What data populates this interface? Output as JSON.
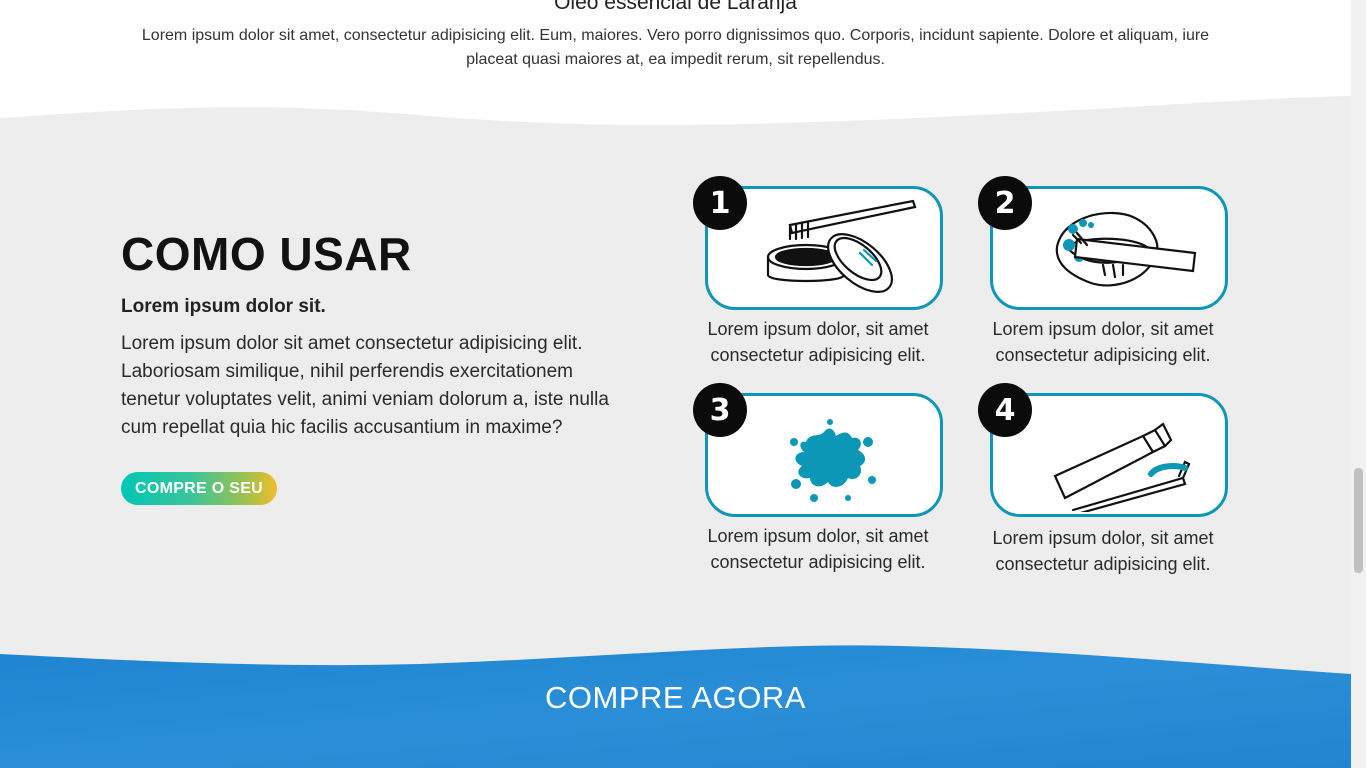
{
  "intro": {
    "title": "Óleo essencial de Laranja",
    "text": "Lorem ipsum dolor sit amet, consectetur adipisicing elit. Eum, maiores. Vero porro dignissimos quo. Corporis, incidunt sapiente. Dolore et aliquam, iure placeat quasi maiores at, ea impedit rerum, sit repellendus."
  },
  "how_to": {
    "title": "COMO USAR",
    "subtitle": "Lorem ipsum dolor sit.",
    "text": "Lorem ipsum dolor sit amet consectetur adipisicing elit. Laboriosam similique, nihil perferendis exercitationem tenetur voluptates velit, animi veniam dolorum a, iste nulla cum repellat quia hic facilis accusantium in maxime?",
    "button_label": "COMPRE O SEU",
    "steps": [
      {
        "number": "1",
        "icon": "toothbrush-powder-jar-icon",
        "caption": "Lorem ipsum dolor, sit amet consectetur adipisicing elit."
      },
      {
        "number": "2",
        "icon": "brushing-teeth-mouth-icon",
        "caption": "Lorem ipsum dolor, sit amet consectetur adipisicing elit."
      },
      {
        "number": "3",
        "icon": "splash-icon",
        "caption": "Lorem ipsum dolor, sit amet consectetur adipisicing elit."
      },
      {
        "number": "4",
        "icon": "toothpaste-toothbrush-icon",
        "caption": "Lorem ipsum dolor, sit amet consectetur adipisicing elit."
      }
    ]
  },
  "buy": {
    "title": "COMPRE AGORA"
  },
  "colors": {
    "accent_teal": "#0d97b6",
    "section_gray": "#ededed",
    "buy_blue": "#2587d4"
  }
}
